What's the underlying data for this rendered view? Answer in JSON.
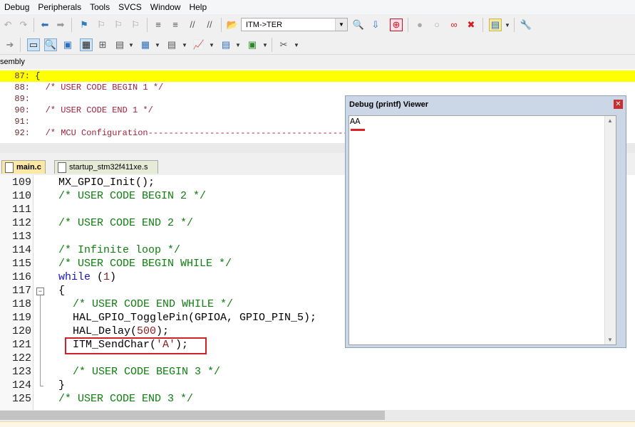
{
  "menu": [
    "Debug",
    "Peripherals",
    "Tools",
    "SVCS",
    "Window",
    "Help"
  ],
  "toolbar": {
    "target_combo": "ITM->TER"
  },
  "disassembly": {
    "tab_label": "sembly",
    "lines": [
      {
        "num": "87:",
        "text": "{"
      },
      {
        "num": "88:",
        "text": "/* USER CODE BEGIN 1 */"
      },
      {
        "num": "89:",
        "text": ""
      },
      {
        "num": "90:",
        "text": "/* USER CODE END 1 */"
      },
      {
        "num": "91:",
        "text": ""
      },
      {
        "num": "92:",
        "text": "/* MCU Configuration--------------------------------------------------------"
      }
    ]
  },
  "tabs": [
    "main.c",
    "startup_stm32f411xe.s"
  ],
  "code": {
    "line_numbers": [
      "109",
      "110",
      "111",
      "112",
      "113",
      "114",
      "115",
      "116",
      "117",
      "118",
      "119",
      "120",
      "121",
      "122",
      "123",
      "124",
      "125"
    ],
    "l109": "MX_GPIO_Init();",
    "l110": "/* USER CODE BEGIN 2 */",
    "l112": "/* USER CODE END 2 */",
    "l114": "/* Infinite loop */",
    "l115": "/* USER CODE BEGIN WHILE */",
    "l116_kw": "while",
    "l116_open": " (",
    "l116_num": "1",
    "l116_close": ")",
    "l117": "{",
    "l118": "/* USER CODE END WHILE */",
    "l119": "HAL_GPIO_TogglePin(GPIOA, GPIO_PIN_5);",
    "l120_a": "HAL_Delay(",
    "l120_num": "500",
    "l120_b": ");",
    "l121_a": "ITM_SendChar(",
    "l121_str": "'A'",
    "l121_b": ");",
    "l123": "/* USER CODE BEGIN 3 */",
    "l124": "}",
    "l125": "/* USER CODE END 3 */"
  },
  "viewer": {
    "title": "Debug (printf) Viewer",
    "output": "AA"
  }
}
